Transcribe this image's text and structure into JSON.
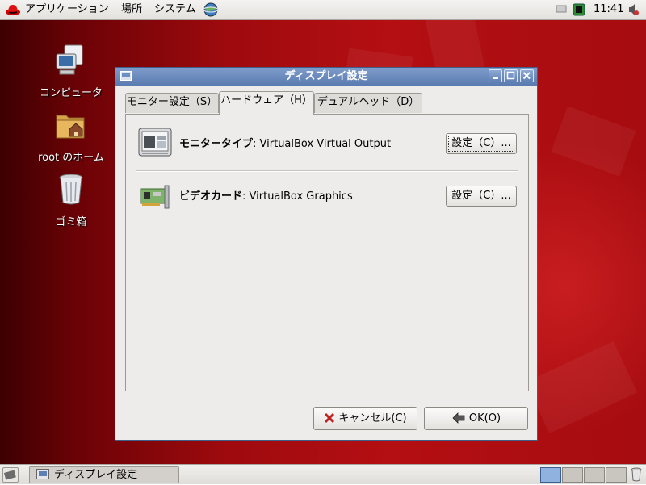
{
  "top_panel": {
    "menus": [
      "アプリケーション",
      "場所",
      "システム"
    ],
    "clock": "11:41"
  },
  "desktop": {
    "icons": [
      {
        "label": "コンピュータ",
        "icon": "computer-icon"
      },
      {
        "label": "root のホーム",
        "icon": "home-folder-icon"
      },
      {
        "label": "ゴミ箱",
        "icon": "trash-icon"
      }
    ]
  },
  "dialog": {
    "title": "ディスプレイ設定",
    "tabs": [
      "モニター設定（S）",
      "ハードウェア（H）",
      "デュアルヘッド（D）"
    ],
    "active_tab": 1,
    "rows": [
      {
        "label": "モニタータイプ",
        "value": "VirtualBox Virtual Output",
        "button": "設定（C）...",
        "icon": "monitor-icon"
      },
      {
        "label": "ビデオカード",
        "value": "VirtualBox Graphics",
        "button": "設定（C）...",
        "icon": "video-card-icon"
      }
    ],
    "cancel_label": "キャンセル(C)",
    "ok_label": "OK(O)"
  },
  "bottom_panel": {
    "task_label": "ディスプレイ設定",
    "workspaces": 4,
    "active_workspace": 0
  },
  "colors": {
    "desktop_red": "#b40f13",
    "titlebar_blue": "#5a7bb0",
    "active_workspace": "#8fb3de"
  }
}
